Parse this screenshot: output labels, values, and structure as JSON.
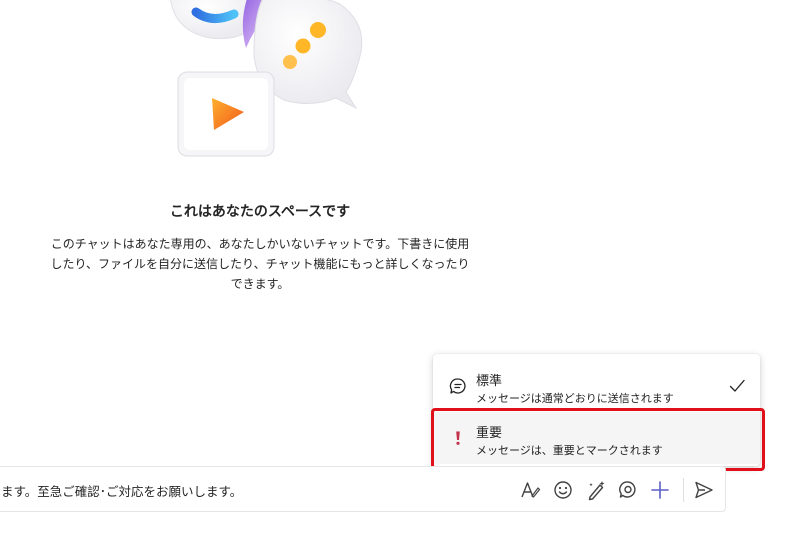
{
  "intro": {
    "title": "これはあなたのスペースです",
    "body": "このチャットはあなた専用の、あなたしかいないチャットです。下書きに使用したり、ファイルを自分に送信したり、チャット機能にもっと詳しくなったりできます。"
  },
  "priority_menu": {
    "items": [
      {
        "title": "標準",
        "description": "メッセージは通常どおりに送信されます",
        "icon": "chat-bubble-icon",
        "selected": true
      },
      {
        "title": "重要",
        "description": "メッセージは、重要とマークされます",
        "icon": "exclamation-icon",
        "selected": false
      }
    ],
    "important_color": "#c4314b",
    "highlight_color": "#e0101b"
  },
  "compose": {
    "text": "ます。至急ご確認･ご対応をお願いします。",
    "toolbar": {
      "format": "format-icon",
      "emoji": "emoji-icon",
      "copilot": "copilot-pen-icon",
      "loop": "loop-icon",
      "add": "plus-icon",
      "send": "send-icon"
    },
    "accent_color": "#5b5fc7"
  }
}
